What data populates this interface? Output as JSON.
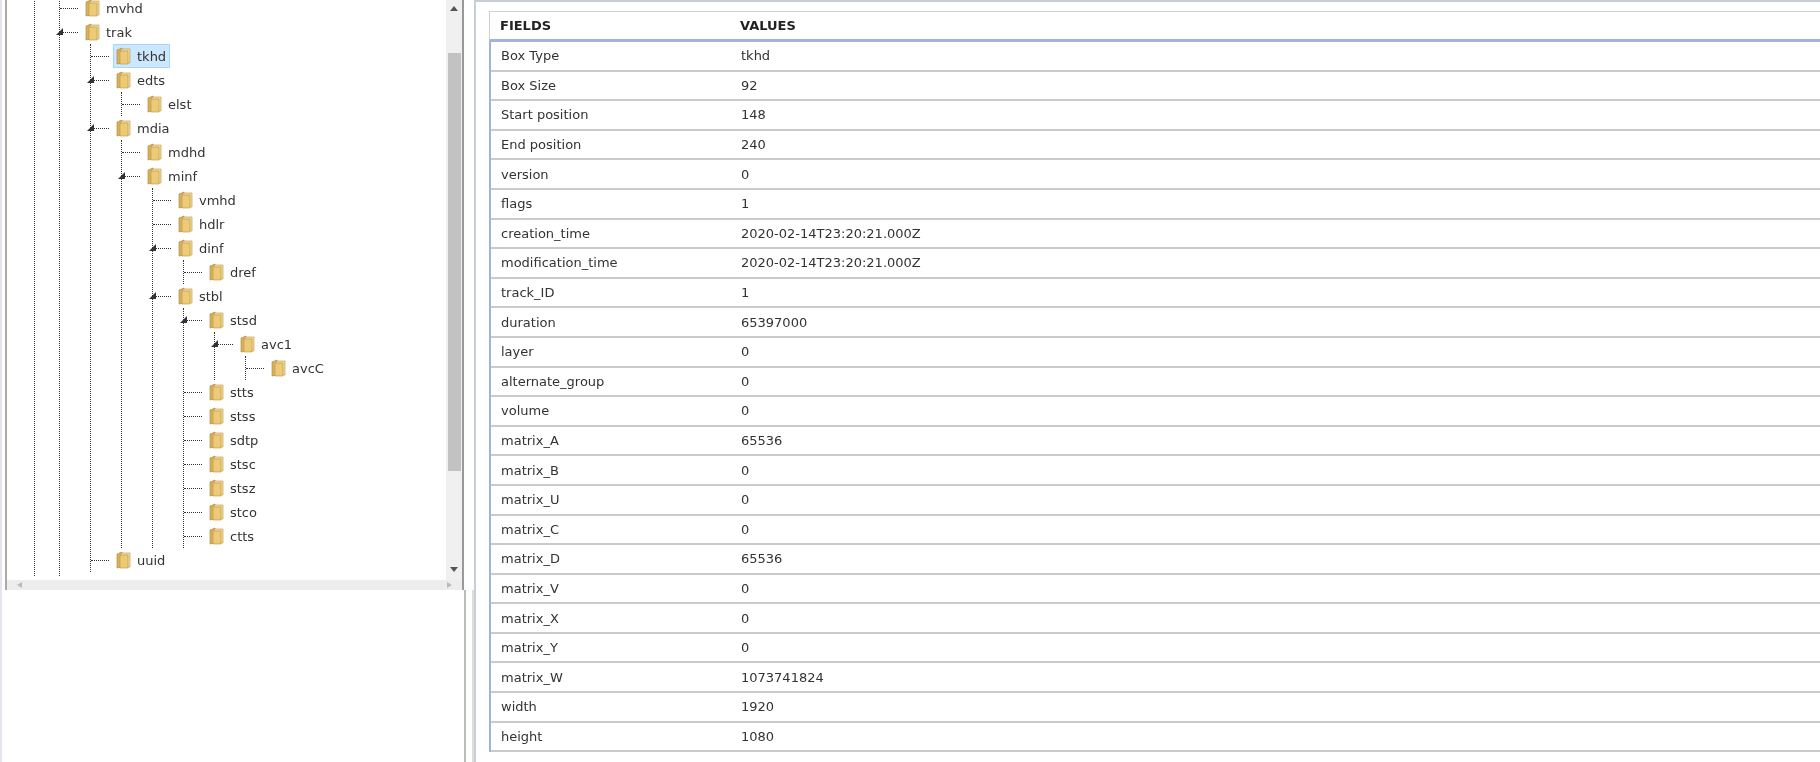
{
  "tree": [
    {
      "label": "mvhd",
      "selected": false
    },
    {
      "label": "trak",
      "selected": false,
      "expanded": true,
      "children": [
        {
          "label": "tkhd",
          "selected": true
        },
        {
          "label": "edts",
          "selected": false,
          "expanded": true,
          "children": [
            {
              "label": "elst",
              "selected": false
            }
          ]
        },
        {
          "label": "mdia",
          "selected": false,
          "expanded": true,
          "children": [
            {
              "label": "mdhd",
              "selected": false
            },
            {
              "label": "minf",
              "selected": false,
              "expanded": true,
              "children": [
                {
                  "label": "vmhd",
                  "selected": false
                },
                {
                  "label": "hdlr",
                  "selected": false
                },
                {
                  "label": "dinf",
                  "selected": false,
                  "expanded": true,
                  "children": [
                    {
                      "label": "dref",
                      "selected": false
                    }
                  ]
                },
                {
                  "label": "stbl",
                  "selected": false,
                  "expanded": true,
                  "children": [
                    {
                      "label": "stsd",
                      "selected": false,
                      "expanded": true,
                      "children": [
                        {
                          "label": "avc1",
                          "selected": false,
                          "expanded": true,
                          "children": [
                            {
                              "label": "avcC",
                              "selected": false
                            }
                          ]
                        }
                      ]
                    },
                    {
                      "label": "stts",
                      "selected": false
                    },
                    {
                      "label": "stss",
                      "selected": false
                    },
                    {
                      "label": "sdtp",
                      "selected": false
                    },
                    {
                      "label": "stsc",
                      "selected": false
                    },
                    {
                      "label": "stsz",
                      "selected": false
                    },
                    {
                      "label": "stco",
                      "selected": false
                    },
                    {
                      "label": "ctts",
                      "selected": false
                    }
                  ]
                }
              ]
            }
          ]
        },
        {
          "label": "uuid",
          "selected": false
        }
      ]
    }
  ],
  "table": {
    "columns": [
      "FIELDS",
      "VALUES"
    ],
    "rows": [
      [
        "Box Type",
        "tkhd"
      ],
      [
        "Box Size",
        "92"
      ],
      [
        "Start position",
        "148"
      ],
      [
        "End position",
        "240"
      ],
      [
        "version",
        "0"
      ],
      [
        "flags",
        "1"
      ],
      [
        "creation_time",
        "2020-02-14T23:20:21.000Z"
      ],
      [
        "modification_time",
        "2020-02-14T23:20:21.000Z"
      ],
      [
        "track_ID",
        "1"
      ],
      [
        "duration",
        "65397000"
      ],
      [
        "layer",
        "0"
      ],
      [
        "alternate_group",
        "0"
      ],
      [
        "volume",
        "0"
      ],
      [
        "matrix_A",
        "65536"
      ],
      [
        "matrix_B",
        "0"
      ],
      [
        "matrix_U",
        "0"
      ],
      [
        "matrix_C",
        "0"
      ],
      [
        "matrix_D",
        "65536"
      ],
      [
        "matrix_V",
        "0"
      ],
      [
        "matrix_X",
        "0"
      ],
      [
        "matrix_Y",
        "0"
      ],
      [
        "matrix_W",
        "1073741824"
      ],
      [
        "width",
        "1920"
      ],
      [
        "height",
        "1080"
      ]
    ]
  }
}
